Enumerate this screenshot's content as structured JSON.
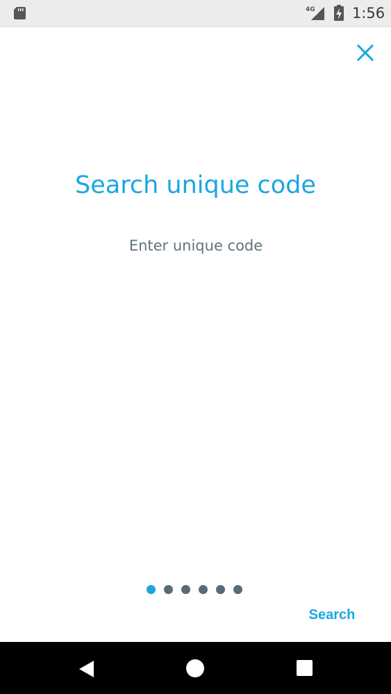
{
  "status_bar": {
    "network_label": "4G",
    "time": "1:56"
  },
  "colors": {
    "accent": "#1aa7e0",
    "text_muted": "#5f7381",
    "dot_inactive": "#5a6b76",
    "status_bar_bg": "#ececec",
    "nav_bar_bg": "#000000"
  },
  "header": {
    "close_icon": "close-icon"
  },
  "main": {
    "title": "Search unique code",
    "code_input": {
      "value": "",
      "placeholder": "Enter unique code"
    }
  },
  "pager": {
    "total_pages": 6,
    "current_page": 1
  },
  "actions": {
    "search_label": "Search"
  },
  "nav_bar": {
    "back_icon": "back-triangle-icon",
    "home_icon": "home-circle-icon",
    "recents_icon": "recents-square-icon"
  }
}
